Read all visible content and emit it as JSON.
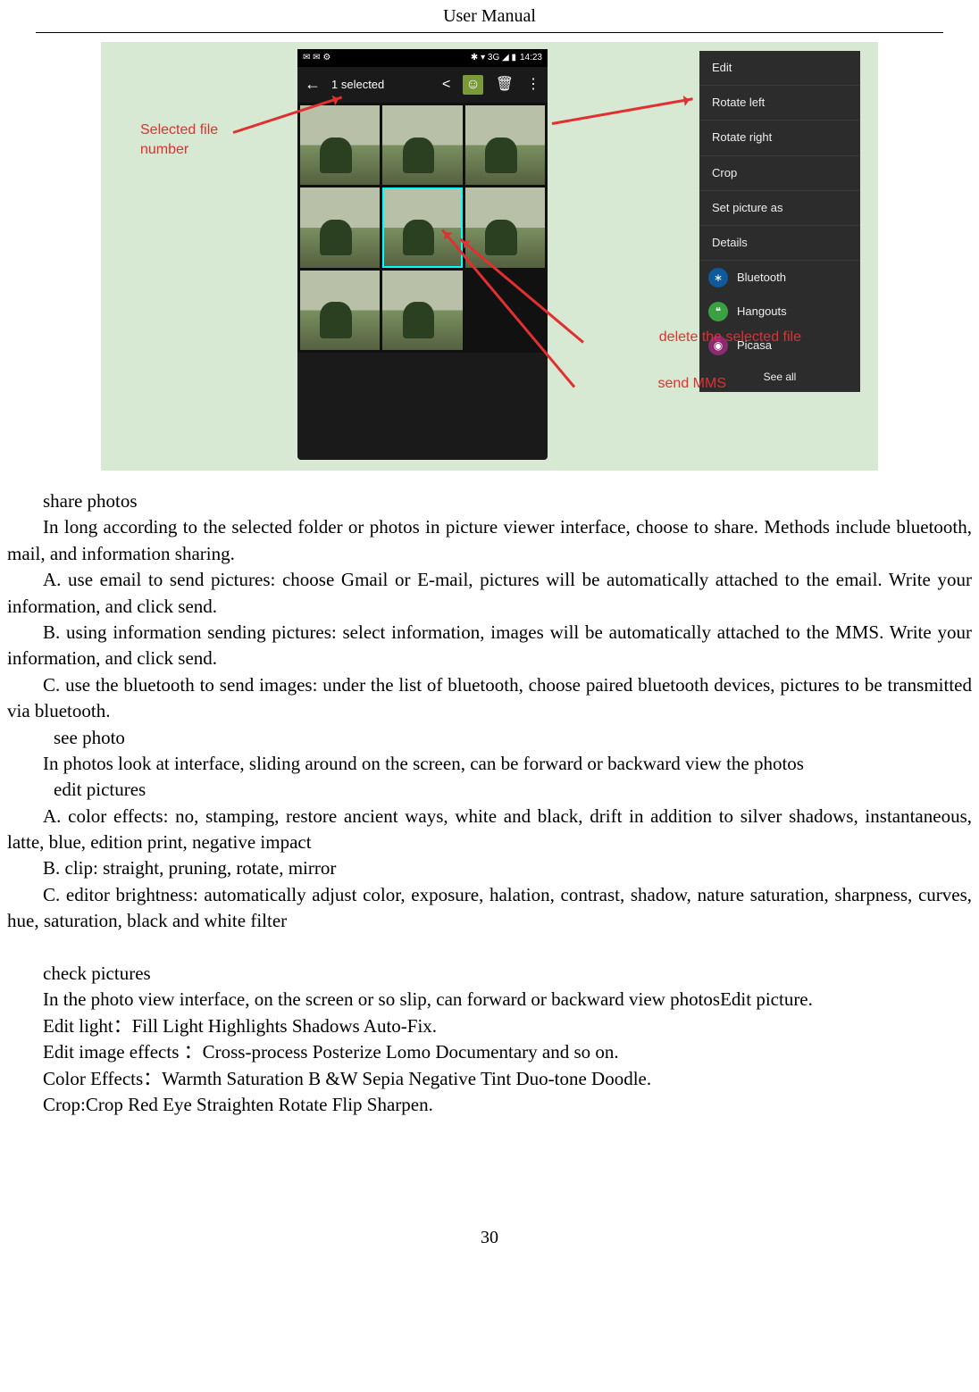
{
  "header": {
    "title": "User    Manual"
  },
  "phone": {
    "status": {
      "icons_left": "✉ ✉ ⚙",
      "icons_right": "✱ ▾ 3G ◢ ▮",
      "time": "14:23"
    },
    "toolbar": {
      "back": "←",
      "title": "1 selected",
      "share": "<",
      "mms": "☺",
      "delete": "🗑",
      "more": "⋮"
    }
  },
  "menu": {
    "edit": "Edit",
    "rotate_left": "Rotate left",
    "rotate_right": "Rotate right",
    "crop": "Crop",
    "set_as": "Set picture as",
    "details": "Details",
    "bluetooth": "Bluetooth",
    "hangouts": "Hangouts",
    "picasa": "Picasa",
    "see_all": "See all"
  },
  "annotations": {
    "selected": "Selected file number",
    "delete": "delete the selected file",
    "mms": "send MMS"
  },
  "body": {
    "p1": "share photos",
    "p2": "In long according to the selected folder or photos in picture viewer interface, choose to share. Methods include bluetooth, mail, and information sharing.",
    "p3": "A. use email to send pictures: choose Gmail or E-mail, pictures will be automatically attached to the email. Write your information, and click send.",
    "p4": "B. using information sending pictures: select information, images will be automatically attached to the MMS. Write your information, and click send.",
    "p5": "C. use the bluetooth to send images: under the list of bluetooth, choose paired bluetooth devices, pictures to be transmitted via bluetooth.",
    "p6": "see photo",
    "p7": "In photos look at interface, sliding around on the screen, can be forward or backward view the photos",
    "p8": "edit pictures",
    "p9": "A. color effects: no, stamping, restore ancient ways, white and black, drift in addition to silver shadows, instantaneous, latte, blue, edition print, negative impact",
    "p10": "B. clip: straight, pruning, rotate, mirror",
    "p11": "C. editor brightness: automatically adjust color, exposure, halation, contrast, shadow, nature saturation, sharpness, curves, hue, saturation, black and white filter",
    "p12": "check pictures",
    "p13": "In the photo view interface, on the screen or so slip, can forward or backward view photosEdit picture.",
    "p14": "Edit light：Fill Light    Highlights    Shadows    Auto-Fix.",
    "p15": "Edit image effects    ：Cross-process    Posterize    Lomo    Documentary and so on.",
    "p16": "Color Effects：Warmth    Saturation B &W    Sepia    Negative    Tint    Duo-tone    Doodle.",
    "p17": "Crop:Crop    Red Eye    Straighten    Rotate    Flip    Sharpen."
  },
  "page_number": "30"
}
